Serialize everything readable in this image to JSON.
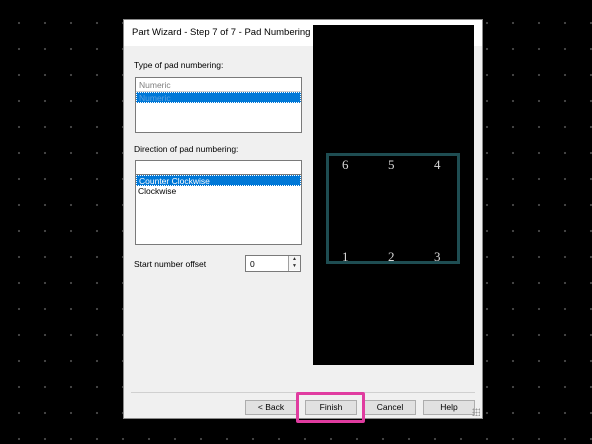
{
  "dialog": {
    "title": "Part Wizard - Step 7 of 7 - Pad Numbering",
    "close_icon": "close-icon"
  },
  "type_section": {
    "label": "Type of pad numbering:",
    "header": "Numeric",
    "selected_item": "Numeric"
  },
  "direction_section": {
    "label": "Direction of pad numbering:",
    "items": [
      "Counter Clockwise",
      "Clockwise"
    ],
    "selected_index": 0
  },
  "offset": {
    "label": "Start number offset",
    "value": "0"
  },
  "preview": {
    "pads_top": [
      "6",
      "5",
      "4"
    ],
    "pads_bottom": [
      "1",
      "2",
      "3"
    ],
    "outline_color": "#1e4d52"
  },
  "buttons": {
    "back": "< Back",
    "finish": "Finish",
    "cancel": "Cancel",
    "help": "Help"
  },
  "colors": {
    "selection": "#0078d7",
    "annotation_highlight": "#e03ca0"
  }
}
